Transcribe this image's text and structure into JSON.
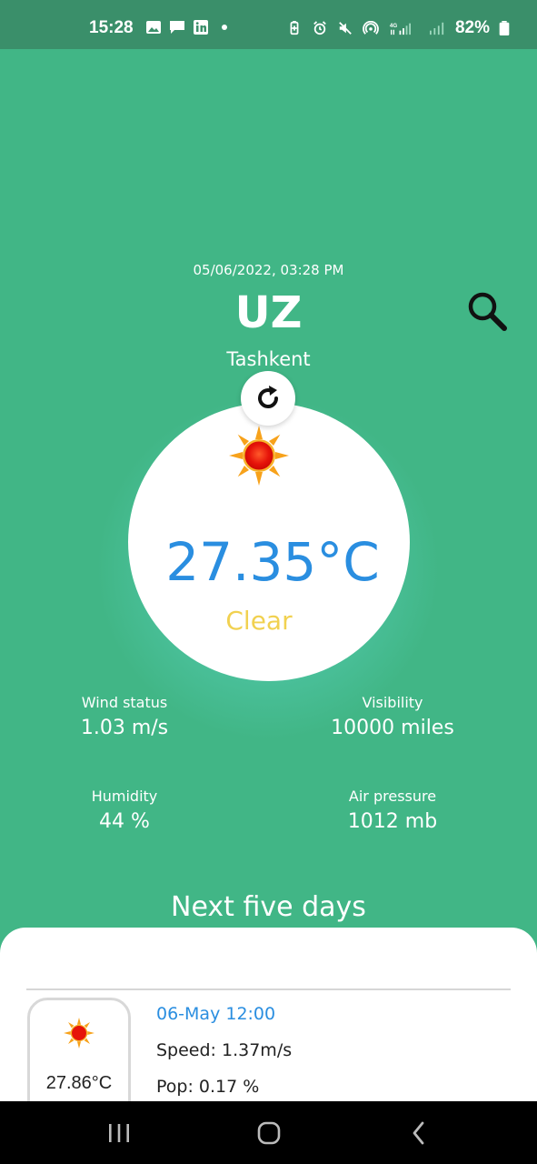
{
  "status_bar": {
    "time": "15:28",
    "battery": "82%",
    "network": "4G"
  },
  "header": {
    "datetime": "05/06/2022, 03:28 PM",
    "country": "UZ",
    "city": "Tashkent"
  },
  "current": {
    "temperature": "27.35°C",
    "condition": "Clear",
    "icon": "sun-icon"
  },
  "stats": {
    "wind_label": "Wind status",
    "wind_value": "1.03 m/s",
    "visibility_label": "Visibility",
    "visibility_value": "10000 miles",
    "humidity_label": "Humidity",
    "humidity_value": "44 %",
    "pressure_label": "Air pressure",
    "pressure_value": "1012 mb"
  },
  "forecast": {
    "title": "Next five days",
    "items": [
      {
        "date": "06-May 12:00",
        "temp": "27.86°C",
        "speed": "Speed: 1.37m/s",
        "pop": "Pop: 0.17 %",
        "icon": "sun-icon"
      }
    ]
  },
  "colors": {
    "background": "#41b686",
    "accent_blue": "#2a8ee0",
    "condition_yellow": "#f1d150"
  }
}
